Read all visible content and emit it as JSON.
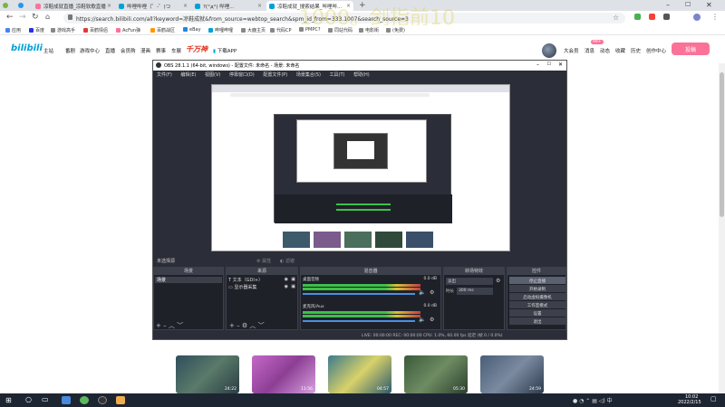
{
  "browser": {
    "tabs": [
      {
        "title": "凉鞋成就直播_凉鞋软歌直播"
      },
      {
        "title": "哔哩哔哩（゜-゜)つ"
      },
      {
        "title": "?(°д°) 哔哩..."
      },
      {
        "title": "凉鞋成就_搜索结果_哔哩哔..."
      }
    ],
    "url": "https://search.bilibili.com/all?keyword=凉鞋成就&from_source=webtop_search&spm_id_from=333.1007&search_source=3",
    "overlay_text": "1000。剑指前10",
    "bookmarks": [
      "应用",
      "百度",
      "游戏高手",
      "百鹤情侣",
      "AcFun弹",
      "百鹤战区",
      "eBay",
      "哔哩哔哩",
      "大鹿主页",
      "代码CP",
      "PMPC?",
      "同站代码",
      "电影街",
      "(免费)"
    ]
  },
  "bili_header": {
    "logo": "bilibili",
    "nav": [
      "主站",
      "番剧",
      "游戏中心",
      "直播",
      "会员购",
      "漫画",
      "赛事",
      "车展",
      "下载APP"
    ],
    "special_logo": "千万神",
    "right": [
      "大会员",
      "消息",
      "动态",
      "收藏",
      "历史",
      "创作中心"
    ],
    "badge": "99+",
    "upload_button": "投稿"
  },
  "obs": {
    "title": "OBS 28.1.1 (64-bit, windows) - 配置文件: 未命名 - 场景: 未命名",
    "menu": [
      "文件(F)",
      "编辑(E)",
      "视图(V)",
      "停靠窗口(D)",
      "配置文件(P)",
      "场景集合(S)",
      "工具(T)",
      "帮助(H)"
    ],
    "no_source": "未选择源",
    "props_label": "属性",
    "filter_label": "滤镜",
    "docks": {
      "scenes": "场景",
      "sources": "来源",
      "mixer": "混音器",
      "transitions": "转场特效",
      "controls": "控件"
    },
    "scene_items": [
      "场景"
    ],
    "source_items": [
      "文本（GDI+）",
      "显示器采集"
    ],
    "mixer_channels": [
      {
        "name": "桌面音频",
        "db": "0.0 dB"
      },
      {
        "name": "麦克风/Aux",
        "db": "0.0 dB"
      }
    ],
    "transition": {
      "type": "淡出",
      "duration_label": "时长",
      "duration": "300 ms"
    },
    "controls": [
      "停止直播",
      "开始录制",
      "启动虚拟摄像机",
      "工作室模式",
      "设置",
      "退出"
    ],
    "status": "LIVE: 00:00:00   REC: 00:00:00   CPU: 1.0%, 60.00 fps   延迟 (帧 0 / 0.0%)"
  },
  "thumbnails": [
    {
      "duration": "24:22"
    },
    {
      "duration": "11:56"
    },
    {
      "duration": "04:57"
    },
    {
      "duration": "05:30"
    },
    {
      "duration": "24:59"
    }
  ],
  "taskbar": {
    "time": "10:02",
    "date": "2022/2/15"
  },
  "colors": {
    "bili_blue": "#00a1d6",
    "bili_pink": "#fb7299",
    "obs_bg": "#2b2e38",
    "taskbar": "#1e2532"
  }
}
